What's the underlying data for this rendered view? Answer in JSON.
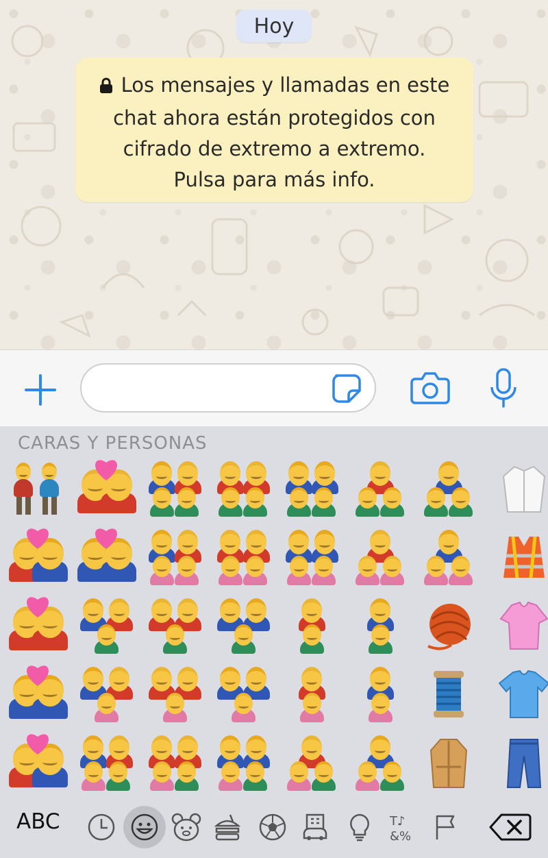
{
  "chat": {
    "date_label": "Hoy",
    "encryption_notice": {
      "lines": [
        "Los mensajes y llamadas en este",
        "chat ahora están protegidos con",
        "cifrado de extremo a extremo.",
        "Pulsa para más info."
      ]
    }
  },
  "input_bar": {
    "icons": [
      "plus-icon",
      "sticker-icon",
      "camera-icon",
      "microphone-icon"
    ],
    "text_value": ""
  },
  "keyboard": {
    "section_title": "CARAS Y PERSONAS",
    "grid": {
      "rows": 5,
      "columns": 8,
      "emojis": [
        [
          "couple-men-holding-hands",
          "kiss-women",
          "family-man-woman-boy-boy",
          "family-woman-woman-boy-boy",
          "family-man-man-boy-boy",
          "family-woman-boy-boy",
          "family-man-boy-boy",
          "lab-coat"
        ],
        [
          "couple-with-heart-woman-man",
          "couple-with-heart-man-man",
          "family-man-woman-girl-girl",
          "family-woman-woman-girl-girl",
          "family-man-man-girl-girl",
          "family-woman-girl-girl",
          "family-man-girl-girl",
          "safety-vest"
        ],
        [
          "couple-with-heart-woman-woman",
          "family-man-woman-boy",
          "family-woman-woman-boy",
          "family-man-man-boy",
          "family-woman-boy",
          "family-man-boy",
          "yarn",
          "blouse"
        ],
        [
          "couple-with-heart-man-man-2",
          "family-man-woman-girl",
          "family-woman-woman-girl",
          "family-man-man-girl",
          "family-woman-girl",
          "family-man-girl",
          "thread",
          "t-shirt"
        ],
        [
          "kiss-man-woman",
          "family-man-woman-girl-boy",
          "family-woman-woman-girl-boy",
          "family-man-man-girl-boy",
          "family-woman-girl-boy",
          "family-man-girl-boy",
          "coat",
          "jeans"
        ]
      ]
    },
    "toolbar": {
      "abc_label": "ABC",
      "categories": [
        "recent-clock-icon",
        "smiley-icon",
        "animal-icon",
        "food-icon",
        "sports-ball-icon",
        "travel-icon",
        "objects-bulb-icon",
        "symbols-icon",
        "flag-icon"
      ],
      "active_category": "smiley-icon",
      "delete_icon": "backspace-icon"
    }
  },
  "colors": {
    "accent_blue": "#2f87e6",
    "bubble_yellow": "#fbf1c0",
    "date_pill": "#dfe6f7",
    "keyboard_bg": "#dcdde2"
  }
}
